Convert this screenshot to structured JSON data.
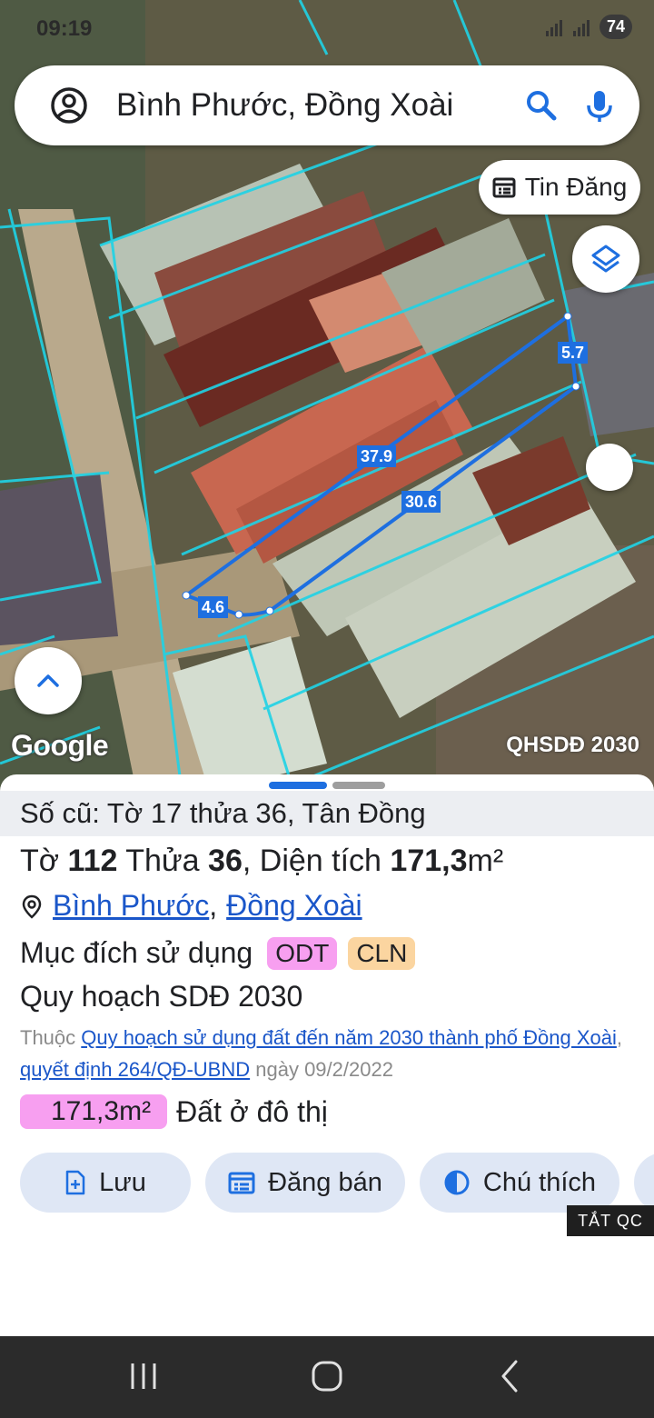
{
  "status_bar": {
    "time": "09:19",
    "battery": "74"
  },
  "search": {
    "query": "Bình Phước, Đồng Xoài"
  },
  "map": {
    "tin_dang_label": "Tin Đăng",
    "provider": "Google",
    "plan_layer": "QHSDĐ 2030",
    "measurements": {
      "top": "37.9",
      "bottom": "30.6",
      "right": "5.7",
      "left": "4.6"
    }
  },
  "parcel": {
    "old_info": "Số cũ: Tờ 17 thửa 36, Tân Đồng",
    "to_label": "Tờ",
    "to_value": "112",
    "thua_label": "Thửa",
    "thua_value": "36",
    "area_label": ", Diện tích",
    "area_value": "171,3",
    "area_unit": "m²",
    "province": "Bình Phước",
    "district": "Đồng Xoài",
    "purpose_label": "Mục đích sử dụng",
    "purpose_tags": [
      "ODT",
      "CLN"
    ],
    "plan_title": "Quy hoạch SDĐ 2030",
    "plan_prefix": "Thuộc",
    "plan_link": "Quy hoạch sử dụng đất đến năm 2030 thành phố Đồng Xoài",
    "decision_link": "quyết định 264/QĐ-UBND",
    "decision_date": "ngày 09/2/2022",
    "land_area": "171,3m²",
    "land_type": "Đất ở đô thị"
  },
  "actions": {
    "save": "Lưu",
    "sell": "Đăng bán",
    "legend": "Chú thích"
  },
  "ad_badge": "TẮT QC",
  "colors": {
    "accent": "#1e6fe0",
    "odt": "#f79ff0",
    "cln": "#fbd5a0",
    "parcel_line": "#1e6fe0",
    "cadastral_line": "#1fd3e6"
  }
}
